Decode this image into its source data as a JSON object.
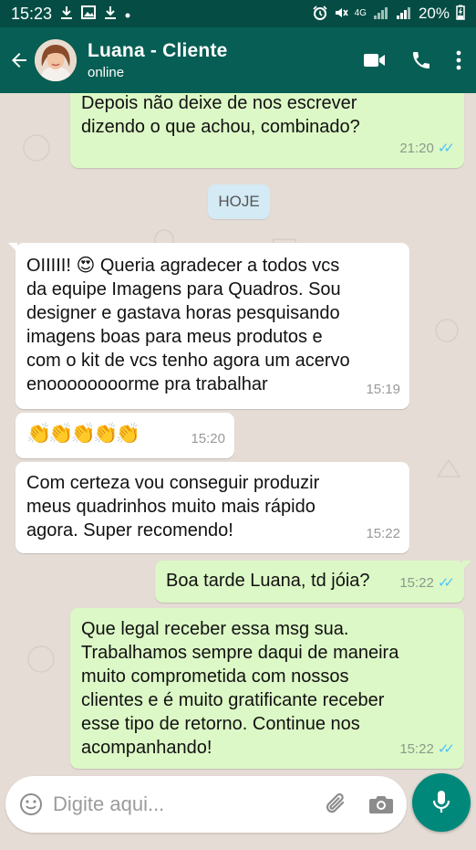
{
  "status_bar": {
    "time": "15:23",
    "network": "4G",
    "battery": "20%"
  },
  "header": {
    "contact_name": "Luana - Cliente",
    "contact_status": "online"
  },
  "messages": [
    {
      "direction": "out",
      "text_lines": [
        "Depois não deixe de nos escrever",
        "dizendo o que achou, combinado?"
      ],
      "time": "21:20",
      "read": true
    },
    {
      "direction": "in",
      "text_lines": [
        "OIIIII! 😍 Queria agradecer a todos vcs",
        "da equipe Imagens para Quadros. Sou",
        "designer e gastava horas pesquisando",
        "imagens boas para meus produtos e",
        "com o kit de vcs tenho agora um acervo",
        "enoooooooorme pra trabalhar"
      ],
      "time": "15:19"
    },
    {
      "direction": "in",
      "text_lines": [
        "👏👏👏👏👏"
      ],
      "time": "15:20"
    },
    {
      "direction": "in",
      "text_lines": [
        "Com certeza vou conseguir produzir",
        "meus quadrinhos muito mais rápido",
        "agora. Super recomendo!"
      ],
      "time": "15:22"
    },
    {
      "direction": "out",
      "text_lines": [
        "Boa tarde Luana, td jóia?"
      ],
      "time": "15:22",
      "read": true
    },
    {
      "direction": "out",
      "text_lines": [
        "Que legal receber essa msg sua.",
        "Trabalhamos sempre daqui de maneira",
        "muito comprometida com nossos",
        "clientes e é muito gratificante receber",
        "esse tipo de retorno. Continue nos",
        "acompanhando!"
      ],
      "time": "15:22",
      "read": true
    }
  ],
  "date_divider": "HOJE",
  "input": {
    "placeholder": "Digite aqui..."
  },
  "colors": {
    "header": "#075e54",
    "statusbar": "#054d44",
    "outgoing_bubble": "#dcf8c6",
    "incoming_bubble": "#ffffff",
    "chat_background": "#e5ddd5",
    "read_ticks": "#4fc3f7",
    "mic_button": "#00897b"
  },
  "icons": {
    "back": "arrow-left-icon",
    "video": "video-camera-icon",
    "call": "phone-icon",
    "menu": "more-vertical-icon",
    "emoji": "smiley-icon",
    "attach": "paperclip-icon",
    "camera": "camera-icon",
    "mic": "microphone-icon"
  }
}
